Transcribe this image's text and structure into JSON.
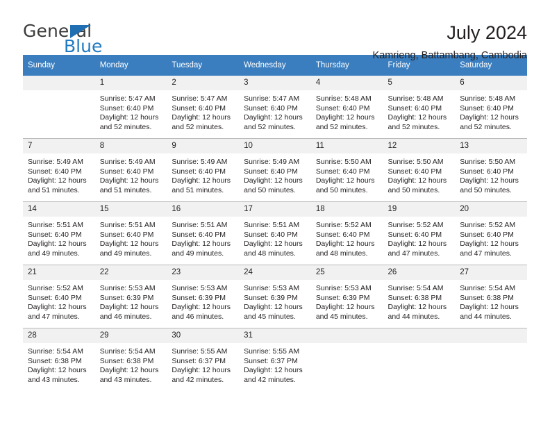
{
  "brand": {
    "name_top": "General",
    "name_bottom": "Blue",
    "triangle_color": "#1f6fb2",
    "blue_color": "#1f7ac0"
  },
  "header": {
    "title": "July 2024",
    "subtitle": "Kamrieng, Battambang, Cambodia"
  },
  "theme": {
    "header_row_bg": "#3a7ebf",
    "daynum_bg": "#f1f1f1",
    "text_color": "#231f20",
    "grid_line": "#b8b8b8"
  },
  "weekdays": [
    "Sunday",
    "Monday",
    "Tuesday",
    "Wednesday",
    "Thursday",
    "Friday",
    "Saturday"
  ],
  "weeks": [
    [
      {
        "day": "",
        "blank": true,
        "sunrise": "",
        "sunset": "",
        "daylight1": "",
        "daylight2": ""
      },
      {
        "day": "1",
        "sunrise": "Sunrise: 5:47 AM",
        "sunset": "Sunset: 6:40 PM",
        "daylight1": "Daylight: 12 hours",
        "daylight2": "and 52 minutes."
      },
      {
        "day": "2",
        "sunrise": "Sunrise: 5:47 AM",
        "sunset": "Sunset: 6:40 PM",
        "daylight1": "Daylight: 12 hours",
        "daylight2": "and 52 minutes."
      },
      {
        "day": "3",
        "sunrise": "Sunrise: 5:47 AM",
        "sunset": "Sunset: 6:40 PM",
        "daylight1": "Daylight: 12 hours",
        "daylight2": "and 52 minutes."
      },
      {
        "day": "4",
        "sunrise": "Sunrise: 5:48 AM",
        "sunset": "Sunset: 6:40 PM",
        "daylight1": "Daylight: 12 hours",
        "daylight2": "and 52 minutes."
      },
      {
        "day": "5",
        "sunrise": "Sunrise: 5:48 AM",
        "sunset": "Sunset: 6:40 PM",
        "daylight1": "Daylight: 12 hours",
        "daylight2": "and 52 minutes."
      },
      {
        "day": "6",
        "sunrise": "Sunrise: 5:48 AM",
        "sunset": "Sunset: 6:40 PM",
        "daylight1": "Daylight: 12 hours",
        "daylight2": "and 52 minutes."
      }
    ],
    [
      {
        "day": "7",
        "sunrise": "Sunrise: 5:49 AM",
        "sunset": "Sunset: 6:40 PM",
        "daylight1": "Daylight: 12 hours",
        "daylight2": "and 51 minutes."
      },
      {
        "day": "8",
        "sunrise": "Sunrise: 5:49 AM",
        "sunset": "Sunset: 6:40 PM",
        "daylight1": "Daylight: 12 hours",
        "daylight2": "and 51 minutes."
      },
      {
        "day": "9",
        "sunrise": "Sunrise: 5:49 AM",
        "sunset": "Sunset: 6:40 PM",
        "daylight1": "Daylight: 12 hours",
        "daylight2": "and 51 minutes."
      },
      {
        "day": "10",
        "sunrise": "Sunrise: 5:49 AM",
        "sunset": "Sunset: 6:40 PM",
        "daylight1": "Daylight: 12 hours",
        "daylight2": "and 50 minutes."
      },
      {
        "day": "11",
        "sunrise": "Sunrise: 5:50 AM",
        "sunset": "Sunset: 6:40 PM",
        "daylight1": "Daylight: 12 hours",
        "daylight2": "and 50 minutes."
      },
      {
        "day": "12",
        "sunrise": "Sunrise: 5:50 AM",
        "sunset": "Sunset: 6:40 PM",
        "daylight1": "Daylight: 12 hours",
        "daylight2": "and 50 minutes."
      },
      {
        "day": "13",
        "sunrise": "Sunrise: 5:50 AM",
        "sunset": "Sunset: 6:40 PM",
        "daylight1": "Daylight: 12 hours",
        "daylight2": "and 50 minutes."
      }
    ],
    [
      {
        "day": "14",
        "sunrise": "Sunrise: 5:51 AM",
        "sunset": "Sunset: 6:40 PM",
        "daylight1": "Daylight: 12 hours",
        "daylight2": "and 49 minutes."
      },
      {
        "day": "15",
        "sunrise": "Sunrise: 5:51 AM",
        "sunset": "Sunset: 6:40 PM",
        "daylight1": "Daylight: 12 hours",
        "daylight2": "and 49 minutes."
      },
      {
        "day": "16",
        "sunrise": "Sunrise: 5:51 AM",
        "sunset": "Sunset: 6:40 PM",
        "daylight1": "Daylight: 12 hours",
        "daylight2": "and 49 minutes."
      },
      {
        "day": "17",
        "sunrise": "Sunrise: 5:51 AM",
        "sunset": "Sunset: 6:40 PM",
        "daylight1": "Daylight: 12 hours",
        "daylight2": "and 48 minutes."
      },
      {
        "day": "18",
        "sunrise": "Sunrise: 5:52 AM",
        "sunset": "Sunset: 6:40 PM",
        "daylight1": "Daylight: 12 hours",
        "daylight2": "and 48 minutes."
      },
      {
        "day": "19",
        "sunrise": "Sunrise: 5:52 AM",
        "sunset": "Sunset: 6:40 PM",
        "daylight1": "Daylight: 12 hours",
        "daylight2": "and 47 minutes."
      },
      {
        "day": "20",
        "sunrise": "Sunrise: 5:52 AM",
        "sunset": "Sunset: 6:40 PM",
        "daylight1": "Daylight: 12 hours",
        "daylight2": "and 47 minutes."
      }
    ],
    [
      {
        "day": "21",
        "sunrise": "Sunrise: 5:52 AM",
        "sunset": "Sunset: 6:40 PM",
        "daylight1": "Daylight: 12 hours",
        "daylight2": "and 47 minutes."
      },
      {
        "day": "22",
        "sunrise": "Sunrise: 5:53 AM",
        "sunset": "Sunset: 6:39 PM",
        "daylight1": "Daylight: 12 hours",
        "daylight2": "and 46 minutes."
      },
      {
        "day": "23",
        "sunrise": "Sunrise: 5:53 AM",
        "sunset": "Sunset: 6:39 PM",
        "daylight1": "Daylight: 12 hours",
        "daylight2": "and 46 minutes."
      },
      {
        "day": "24",
        "sunrise": "Sunrise: 5:53 AM",
        "sunset": "Sunset: 6:39 PM",
        "daylight1": "Daylight: 12 hours",
        "daylight2": "and 45 minutes."
      },
      {
        "day": "25",
        "sunrise": "Sunrise: 5:53 AM",
        "sunset": "Sunset: 6:39 PM",
        "daylight1": "Daylight: 12 hours",
        "daylight2": "and 45 minutes."
      },
      {
        "day": "26",
        "sunrise": "Sunrise: 5:54 AM",
        "sunset": "Sunset: 6:38 PM",
        "daylight1": "Daylight: 12 hours",
        "daylight2": "and 44 minutes."
      },
      {
        "day": "27",
        "sunrise": "Sunrise: 5:54 AM",
        "sunset": "Sunset: 6:38 PM",
        "daylight1": "Daylight: 12 hours",
        "daylight2": "and 44 minutes."
      }
    ],
    [
      {
        "day": "28",
        "sunrise": "Sunrise: 5:54 AM",
        "sunset": "Sunset: 6:38 PM",
        "daylight1": "Daylight: 12 hours",
        "daylight2": "and 43 minutes."
      },
      {
        "day": "29",
        "sunrise": "Sunrise: 5:54 AM",
        "sunset": "Sunset: 6:38 PM",
        "daylight1": "Daylight: 12 hours",
        "daylight2": "and 43 minutes."
      },
      {
        "day": "30",
        "sunrise": "Sunrise: 5:55 AM",
        "sunset": "Sunset: 6:37 PM",
        "daylight1": "Daylight: 12 hours",
        "daylight2": "and 42 minutes."
      },
      {
        "day": "31",
        "sunrise": "Sunrise: 5:55 AM",
        "sunset": "Sunset: 6:37 PM",
        "daylight1": "Daylight: 12 hours",
        "daylight2": "and 42 minutes."
      },
      {
        "day": "",
        "blank": true,
        "sunrise": "",
        "sunset": "",
        "daylight1": "",
        "daylight2": ""
      },
      {
        "day": "",
        "blank": true,
        "sunrise": "",
        "sunset": "",
        "daylight1": "",
        "daylight2": ""
      },
      {
        "day": "",
        "blank": true,
        "sunrise": "",
        "sunset": "",
        "daylight1": "",
        "daylight2": ""
      }
    ]
  ]
}
